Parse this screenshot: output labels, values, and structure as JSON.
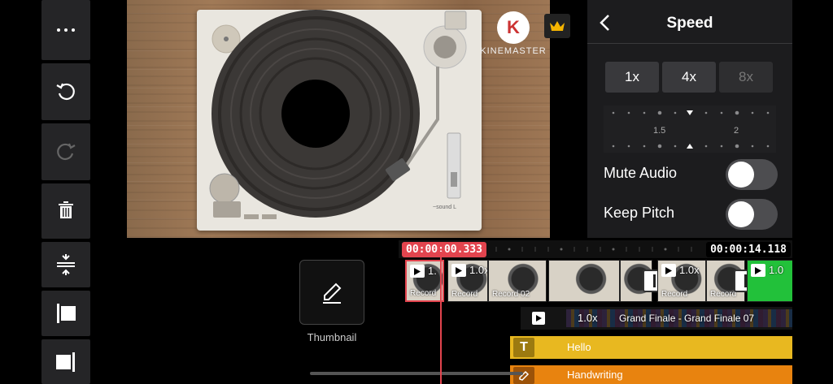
{
  "toolbar": {
    "items": [
      "more-options",
      "undo",
      "redo",
      "delete",
      "split",
      "trim-start",
      "trim-end"
    ]
  },
  "preview": {
    "logo_letter": "K",
    "logo_text": "KINEMASTER",
    "turntable_brand": "~sound L"
  },
  "panel": {
    "title": "Speed",
    "speed_options": [
      "1x",
      "4x",
      "8x"
    ],
    "speed_disabled": "8x",
    "ruler_labels": [
      "1.5",
      "2"
    ],
    "mute_audio_label": "Mute Audio",
    "mute_audio_on": false,
    "keep_pitch_label": "Keep Pitch",
    "keep_pitch_on": false
  },
  "timeline": {
    "thumbnail_label": "Thumbnail",
    "current_time": "00:00:00.333",
    "total_time": "00:00:14.118",
    "clips": [
      {
        "speed": "1.",
        "label": "Record"
      },
      {
        "speed": "1.0x",
        "label": "Record"
      },
      {
        "speed": "",
        "label": "Record 02"
      },
      {
        "speed": "",
        "label": ""
      },
      {
        "speed": "",
        "label": ""
      },
      {
        "speed": "1.0x",
        "label": "Record"
      },
      {
        "speed": "",
        "label": "Record"
      },
      {
        "speed": "1.0",
        "label": ""
      }
    ],
    "audio_speed": "1.0x",
    "audio_label": "Grand Finale - Grand Finale 07",
    "text_layer_label": "Hello",
    "text_layer_icon": "T",
    "handwriting_layer_label": "Handwriting"
  },
  "colors": {
    "accent_red": "#e2444e",
    "text_layer": "#e8b820",
    "handwriting_layer": "#e8830f",
    "panel_bg": "#1c1c1e"
  }
}
